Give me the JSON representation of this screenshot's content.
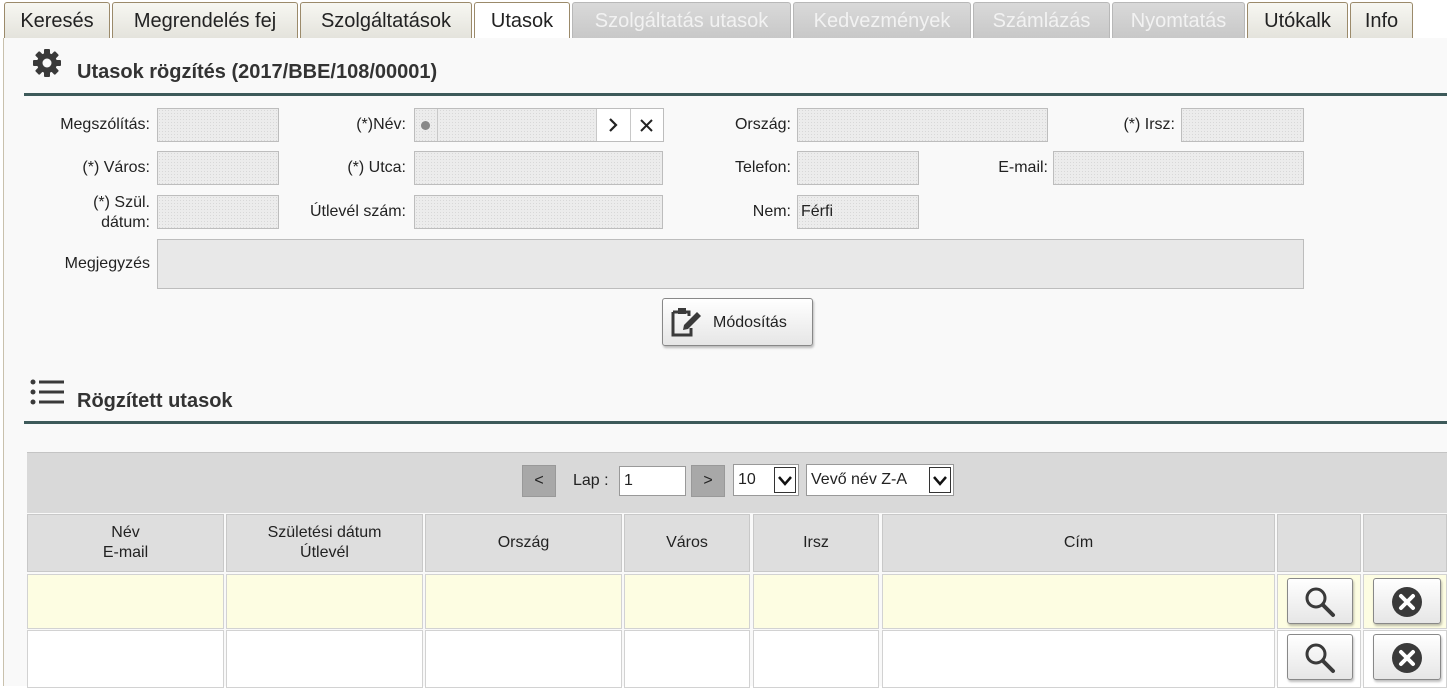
{
  "tabs": [
    {
      "label": "Keresés"
    },
    {
      "label": "Megrendelés fej"
    },
    {
      "label": "Szolgáltatások"
    },
    {
      "label": "Utasok"
    },
    {
      "label": "Szolgáltatás utasok"
    },
    {
      "label": "Kedvezmények"
    },
    {
      "label": "Számlázás"
    },
    {
      "label": "Nyomtatás"
    },
    {
      "label": "Utókalk"
    },
    {
      "label": "Info"
    }
  ],
  "form": {
    "title": "Utasok rögzítés (2017/BBE/108/00001)",
    "salutation_label": "Megszólítás:",
    "name_label": "(*)Név:",
    "country_label": "Ország:",
    "zip_label": "(*) Irsz:",
    "city_label": "(*) Város:",
    "street_label": "(*) Utca:",
    "phone_label": "Telefon:",
    "email_label": "E-mail:",
    "birth_label_1": "(*) Szül.",
    "birth_label_2": "dátum:",
    "passport_label": "Útlevél szám:",
    "gender_label": "Nem:",
    "gender_value": "Férfi",
    "note_label": "Megjegyzés",
    "modify_button": "Módosítás"
  },
  "list": {
    "title": "Rögzített utasok",
    "prev": "<",
    "next": ">",
    "page_label": "Lap :",
    "page_value": "1",
    "page_size": "10",
    "sort": "Vevő név Z-A",
    "headers": {
      "name_1": "Név",
      "name_2": "E-mail",
      "birth_1": "Születési dátum",
      "birth_2": "Útlevél",
      "country": "Ország",
      "city": "Város",
      "zip": "Irsz",
      "address": "Cím"
    }
  }
}
